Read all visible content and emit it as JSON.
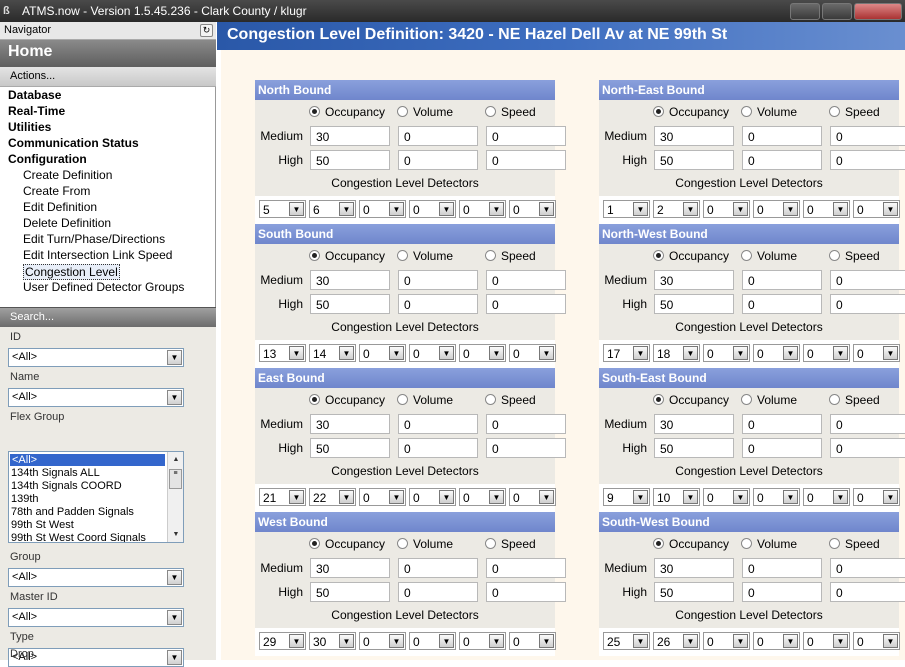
{
  "window": {
    "title": "ATMS.now - Version 1.5.45.236 - Clark County / klugr"
  },
  "navigator": {
    "header": "Navigator",
    "home": "Home",
    "actions": "Actions...",
    "tree": [
      {
        "label": "Database",
        "bold": true
      },
      {
        "label": "Real-Time",
        "bold": true
      },
      {
        "label": "Utilities",
        "bold": true
      },
      {
        "label": "Communication Status",
        "bold": true
      },
      {
        "label": "Configuration",
        "bold": true
      },
      {
        "label": "Create Definition",
        "bold": false
      },
      {
        "label": "Create From",
        "bold": false
      },
      {
        "label": "Edit Definition",
        "bold": false
      },
      {
        "label": "Delete Definition",
        "bold": false
      },
      {
        "label": "Edit Turn/Phase/Directions",
        "bold": false
      },
      {
        "label": "Edit Intersection Link Speed",
        "bold": false
      },
      {
        "label": "Congestion Level",
        "bold": false,
        "selected": true
      },
      {
        "label": "User Defined Detector Groups",
        "bold": false
      }
    ],
    "search": "Search...",
    "filters": {
      "id": {
        "label": "ID",
        "value": "<All>"
      },
      "name": {
        "label": "Name",
        "value": "<All>"
      },
      "flex_group": {
        "label": "Flex Group",
        "items": [
          "<All>",
          "134th Signals ALL",
          "134th Signals COORD",
          "139th",
          "78th and Padden Signals",
          "99th St West",
          "99th St West Coord Signals"
        ],
        "selected": "<All>"
      },
      "group": {
        "label": "Group",
        "value": "<All>"
      },
      "master_id": {
        "label": "Master ID",
        "value": "<All>"
      },
      "type": {
        "label": "Type",
        "value": "<All>"
      },
      "drop": {
        "label": "Drop"
      }
    }
  },
  "main": {
    "title": "Congestion Level Definition: 3420 - NE Hazel Dell Av at NE 99th St",
    "labels": {
      "occupancy": "Occupancy",
      "volume": "Volume",
      "speed": "Speed",
      "medium": "Medium",
      "high": "High",
      "detectors": "Congestion Level Detectors"
    },
    "panels": [
      {
        "title": "North Bound",
        "selected": "occupancy",
        "medium": [
          "30",
          "0",
          "0"
        ],
        "high": [
          "50",
          "0",
          "0"
        ],
        "detectors": [
          "5",
          "6",
          "0",
          "0",
          "0",
          "0"
        ]
      },
      {
        "title": "North-East Bound",
        "selected": "occupancy",
        "medium": [
          "30",
          "0",
          "0"
        ],
        "high": [
          "50",
          "0",
          "0"
        ],
        "detectors": [
          "1",
          "2",
          "0",
          "0",
          "0",
          "0"
        ]
      },
      {
        "title": "South Bound",
        "selected": "occupancy",
        "medium": [
          "30",
          "0",
          "0"
        ],
        "high": [
          "50",
          "0",
          "0"
        ],
        "detectors": [
          "13",
          "14",
          "0",
          "0",
          "0",
          "0"
        ]
      },
      {
        "title": "North-West Bound",
        "selected": "occupancy",
        "medium": [
          "30",
          "0",
          "0"
        ],
        "high": [
          "50",
          "0",
          "0"
        ],
        "detectors": [
          "17",
          "18",
          "0",
          "0",
          "0",
          "0"
        ]
      },
      {
        "title": "East Bound",
        "selected": "occupancy",
        "medium": [
          "30",
          "0",
          "0"
        ],
        "high": [
          "50",
          "0",
          "0"
        ],
        "detectors": [
          "21",
          "22",
          "0",
          "0",
          "0",
          "0"
        ]
      },
      {
        "title": "South-East Bound",
        "selected": "occupancy",
        "medium": [
          "30",
          "0",
          "0"
        ],
        "high": [
          "50",
          "0",
          "0"
        ],
        "detectors": [
          "9",
          "10",
          "0",
          "0",
          "0",
          "0"
        ]
      },
      {
        "title": "West Bound",
        "selected": "occupancy",
        "medium": [
          "30",
          "0",
          "0"
        ],
        "high": [
          "50",
          "0",
          "0"
        ],
        "detectors": [
          "29",
          "30",
          "0",
          "0",
          "0",
          "0"
        ]
      },
      {
        "title": "South-West Bound",
        "selected": "occupancy",
        "medium": [
          "30",
          "0",
          "0"
        ],
        "high": [
          "50",
          "0",
          "0"
        ],
        "detectors": [
          "25",
          "26",
          "0",
          "0",
          "0",
          "0"
        ]
      }
    ]
  }
}
